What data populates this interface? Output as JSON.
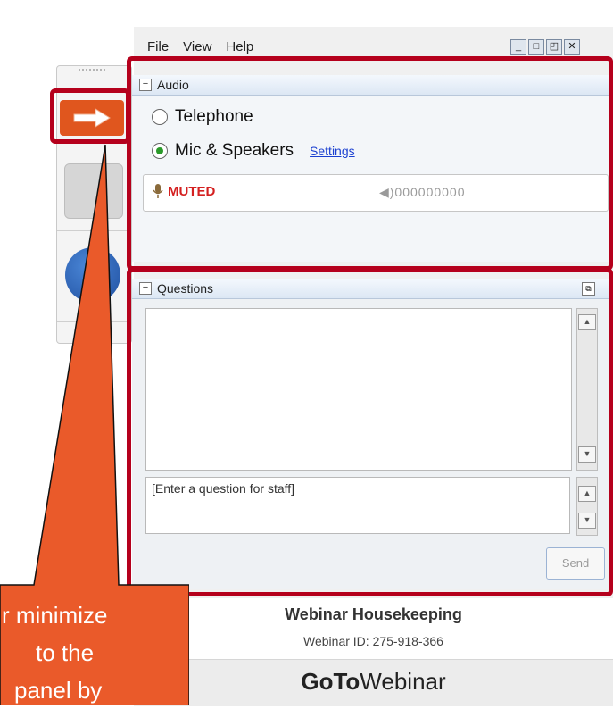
{
  "menu": {
    "file": "File",
    "view": "View",
    "help": "Help"
  },
  "audio": {
    "header": "Audio",
    "telephone": "Telephone",
    "mic_speakers": "Mic & Speakers",
    "settings": "Settings",
    "muted": "MUTED",
    "level": "◀)000000000"
  },
  "questions": {
    "header": "Questions",
    "placeholder": "[Enter a question for staff]",
    "send": "Send"
  },
  "footer": {
    "title": "Webinar Housekeeping",
    "webinar_id": "Webinar ID: 275-918-366",
    "brand_bold": "GoTo",
    "brand_light": "Webinar"
  },
  "callout": {
    "line1": "r minimize",
    "line2": "to the",
    "line3": "panel by"
  },
  "colors": {
    "accent_red": "#b5001c",
    "callout_orange": "#ea5a2a",
    "arrow_orange": "#e0561e"
  },
  "icons": {
    "window_controls": [
      "minimize-icon",
      "maximize-icon",
      "restore-icon",
      "close-icon"
    ]
  }
}
